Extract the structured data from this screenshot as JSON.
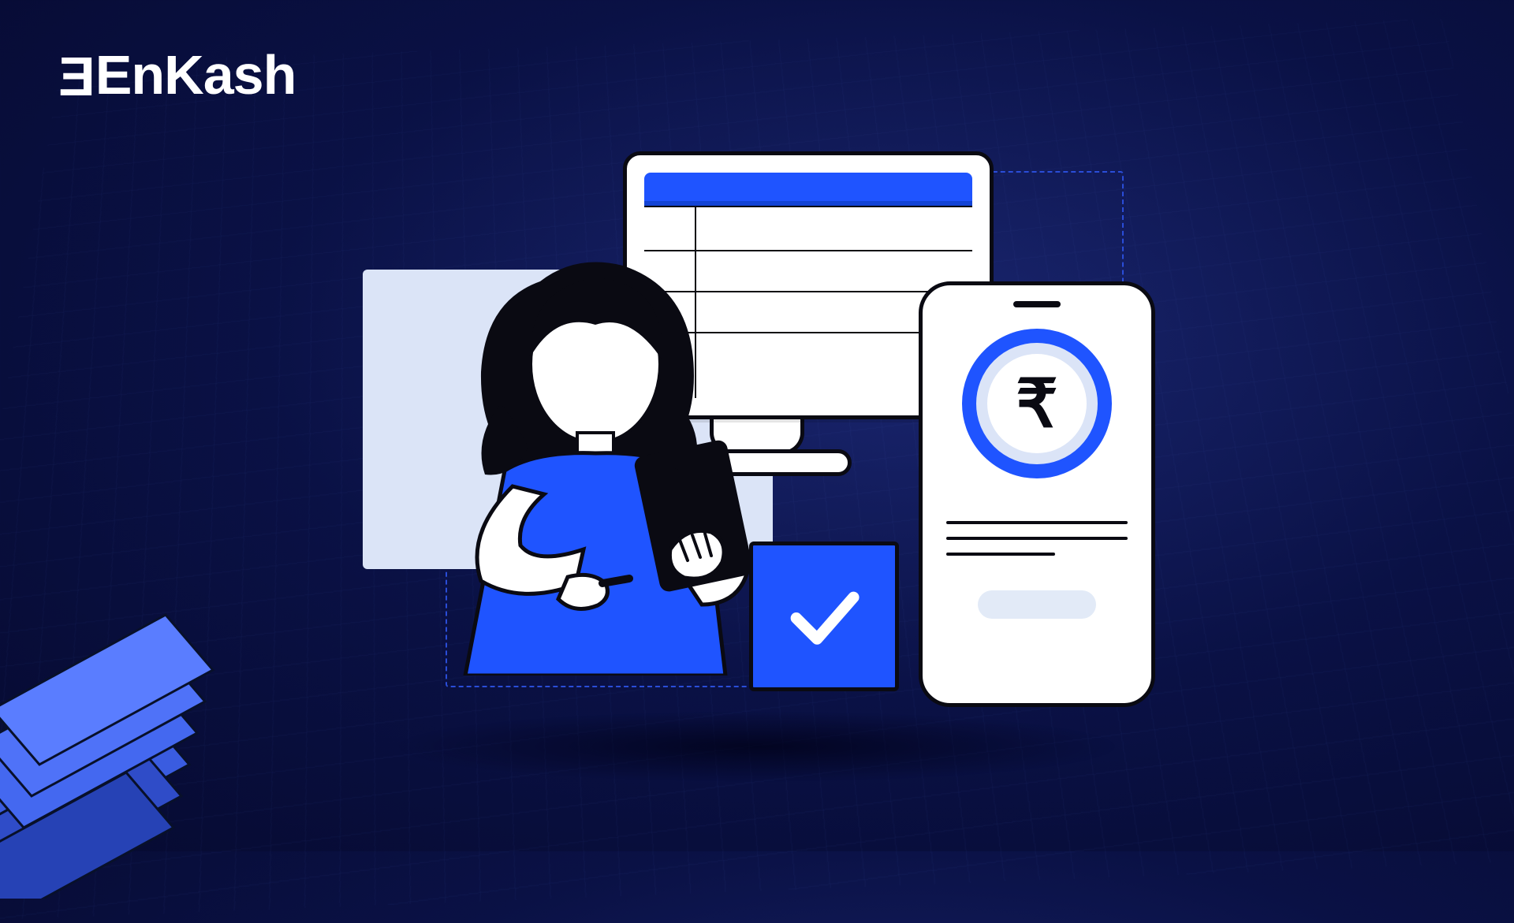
{
  "brand": {
    "name": "EnKash"
  },
  "colors": {
    "bg_deep": "#060a30",
    "bg_mid": "#1a2670",
    "accent": "#1f54ff",
    "light": "#dbe4f7",
    "ink": "#0a0a12",
    "white": "#ffffff"
  },
  "illustration": {
    "elements": [
      "woman-with-tablet",
      "desktop-monitor-spreadsheet",
      "smartphone-rupee",
      "checkbox-checked",
      "stacked-3d-panels"
    ],
    "currency_symbol": "₹",
    "checkbox_state": "checked"
  }
}
